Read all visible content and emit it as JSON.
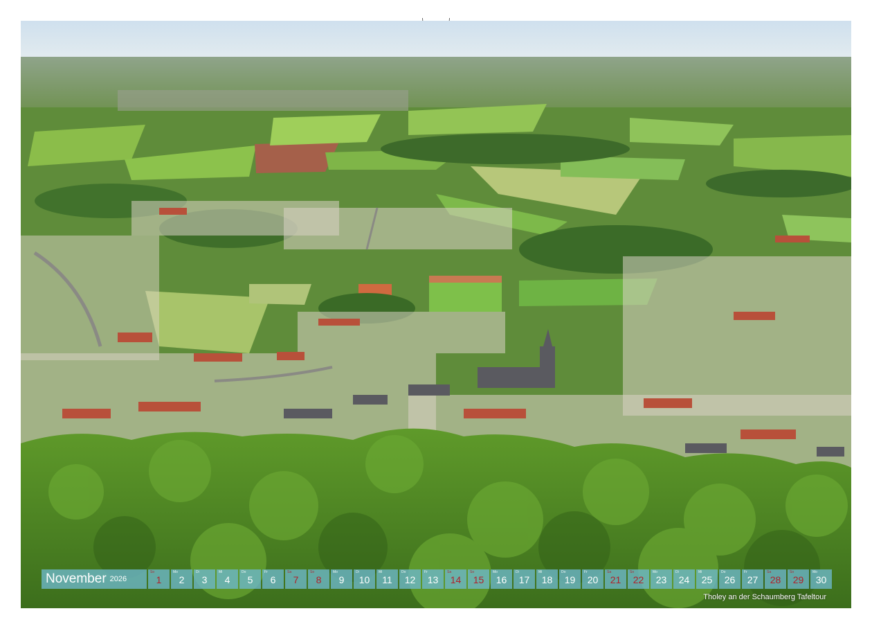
{
  "calendar": {
    "month": "November",
    "year": "2026",
    "days": [
      {
        "wd": "So",
        "num": "1",
        "sun": true
      },
      {
        "wd": "Mo",
        "num": "2",
        "sun": false
      },
      {
        "wd": "Di",
        "num": "3",
        "sun": false
      },
      {
        "wd": "Mi",
        "num": "4",
        "sun": false
      },
      {
        "wd": "Do",
        "num": "5",
        "sun": false
      },
      {
        "wd": "Fr",
        "num": "6",
        "sun": false
      },
      {
        "wd": "Sa",
        "num": "7",
        "sun": true
      },
      {
        "wd": "So",
        "num": "8",
        "sun": true
      },
      {
        "wd": "Mo",
        "num": "9",
        "sun": false
      },
      {
        "wd": "Di",
        "num": "10",
        "sun": false
      },
      {
        "wd": "Mi",
        "num": "11",
        "sun": false
      },
      {
        "wd": "Do",
        "num": "12",
        "sun": false
      },
      {
        "wd": "Fr",
        "num": "13",
        "sun": false
      },
      {
        "wd": "Sa",
        "num": "14",
        "sun": true
      },
      {
        "wd": "So",
        "num": "15",
        "sun": true
      },
      {
        "wd": "Mo",
        "num": "16",
        "sun": false
      },
      {
        "wd": "Di",
        "num": "17",
        "sun": false
      },
      {
        "wd": "Mi",
        "num": "18",
        "sun": false
      },
      {
        "wd": "Do",
        "num": "19",
        "sun": false
      },
      {
        "wd": "Fr",
        "num": "20",
        "sun": false
      },
      {
        "wd": "Sa",
        "num": "21",
        "sun": true
      },
      {
        "wd": "So",
        "num": "22",
        "sun": true
      },
      {
        "wd": "Mo",
        "num": "23",
        "sun": false
      },
      {
        "wd": "Di",
        "num": "24",
        "sun": false
      },
      {
        "wd": "Mi",
        "num": "25",
        "sun": false
      },
      {
        "wd": "Do",
        "num": "26",
        "sun": false
      },
      {
        "wd": "Fr",
        "num": "27",
        "sun": false
      },
      {
        "wd": "Sa",
        "num": "28",
        "sun": true
      },
      {
        "wd": "So",
        "num": "29",
        "sun": true
      },
      {
        "wd": "Mo",
        "num": "30",
        "sun": false
      }
    ]
  },
  "caption": "Tholey an der Schaumberg Tafeltour",
  "colors": {
    "calendar_bar": "#6eb9cd",
    "weekend_text": "#b0202a"
  }
}
